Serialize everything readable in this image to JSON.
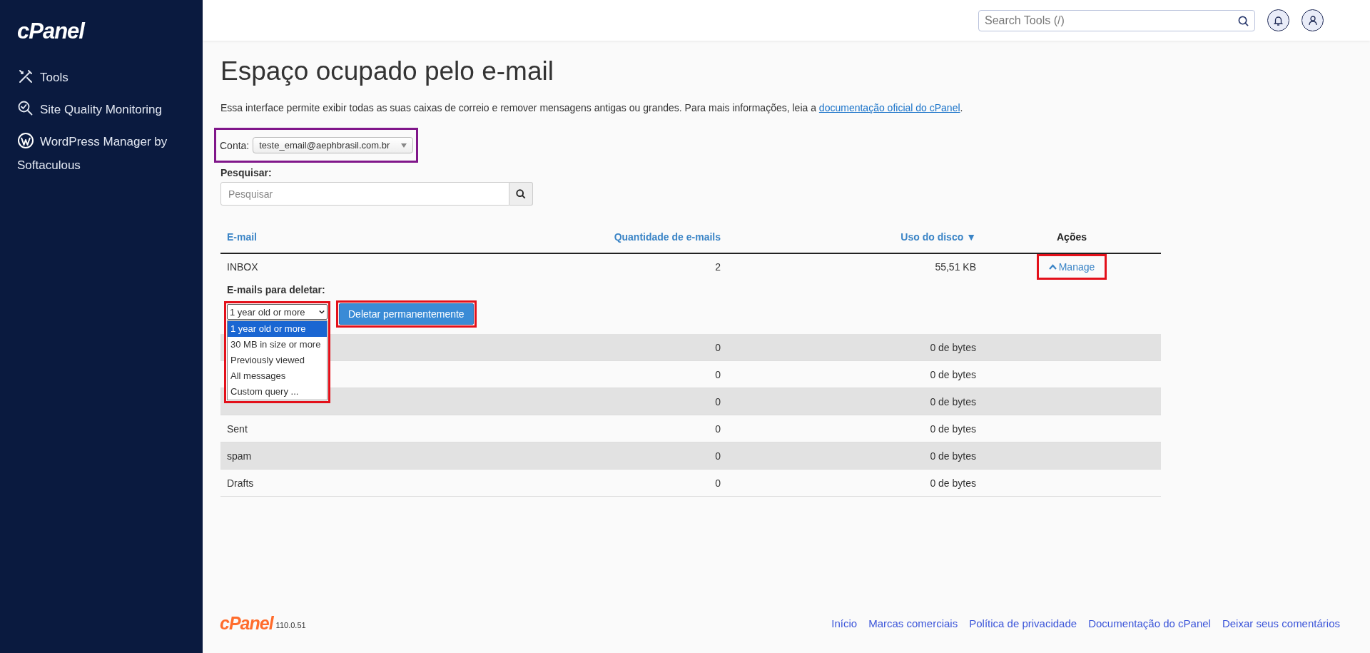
{
  "sidebar": {
    "logo": "cPanel",
    "items": [
      {
        "kind": "tools",
        "label": "Tools"
      },
      {
        "kind": "monitor",
        "label": "Site Quality Monitoring"
      },
      {
        "kind": "wordpress",
        "label": "WordPress Manager by Softaculous"
      }
    ]
  },
  "header": {
    "search": {
      "placeholder": "Search Tools (/)"
    }
  },
  "page": {
    "title": "Espaço ocupado pelo e-mail",
    "description": "Essa interface permite exibir todas as suas caixas de correio e remover mensagens antigas ou grandes. Para mais informações, leia a ",
    "description_link": "documentação oficial do cPanel",
    "description_end": ".",
    "account": {
      "label": "Conta:",
      "value": "teste_email@aephbrasil.com.br"
    },
    "search": {
      "label": "Pesquisar:",
      "placeholder": "Pesquisar"
    }
  },
  "table": {
    "columns": [
      {
        "label": "E-mail",
        "kind": "sortable"
      },
      {
        "label": "Quantidade de e-mails",
        "kind": "sortable"
      },
      {
        "label": "Uso do disco ▼",
        "kind": "sortable"
      },
      {
        "label": "Ações",
        "kind": "plain"
      }
    ],
    "rows": [
      {
        "name": "INBOX",
        "count": "2",
        "size": "55,51 KB",
        "action": "Manage",
        "expanded": true
      },
      {
        "count": "0",
        "size": "0 de bytes"
      },
      {
        "count": "0",
        "size": "0 de bytes"
      },
      {
        "count": "0",
        "size": "0 de bytes"
      },
      {
        "name": "Sent",
        "count": "0",
        "size": "0 de bytes"
      },
      {
        "name": "spam",
        "count": "0",
        "size": "0 de bytes"
      },
      {
        "name": "Drafts",
        "count": "0",
        "size": "0 de bytes"
      }
    ]
  },
  "delete_panel": {
    "label": "E-mails para deletar:",
    "select": {
      "value": "1 year old or more",
      "expanded": true,
      "options": [
        {
          "label": "1 year old or more",
          "selected": true
        },
        {
          "label": "30 MB in size or more",
          "selected": false
        },
        {
          "label": "Previously viewed",
          "selected": false
        },
        {
          "label": "All messages",
          "selected": false
        },
        {
          "label": "Custom query ...",
          "selected": false
        }
      ]
    },
    "button": "Deletar permanentemente"
  },
  "footer": {
    "logo": "cPanel",
    "version": "110.0.51",
    "links": [
      "Início",
      "Marcas comerciais",
      "Política de privacidade",
      "Documentação do cPanel",
      "Deixar seus comentários"
    ]
  }
}
